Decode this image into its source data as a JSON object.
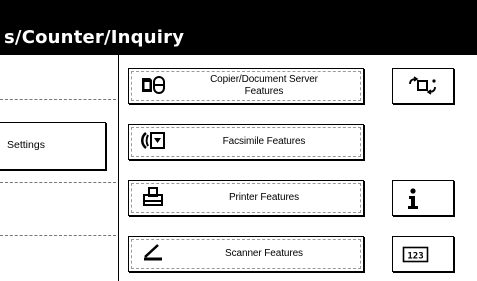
{
  "header": {
    "title": "s/Counter/Inquiry"
  },
  "left": {
    "settings_label": "Settings"
  },
  "features": [
    {
      "label": "Copier/Document Server\nFeatures",
      "icon": "copier-document-server-icon"
    },
    {
      "label": "Facsimile Features",
      "icon": "facsimile-icon"
    },
    {
      "label": "Printer Features",
      "icon": "printer-icon"
    },
    {
      "label": "Scanner Features",
      "icon": "scanner-icon"
    }
  ],
  "side_buttons": [
    {
      "icon": "language-change-icon"
    },
    {
      "icon": "information-icon"
    },
    {
      "icon": "counter-icon",
      "text": "123"
    }
  ],
  "colors": {
    "title_bar": "#000000",
    "background": "#ffffff",
    "text": "#000000"
  }
}
